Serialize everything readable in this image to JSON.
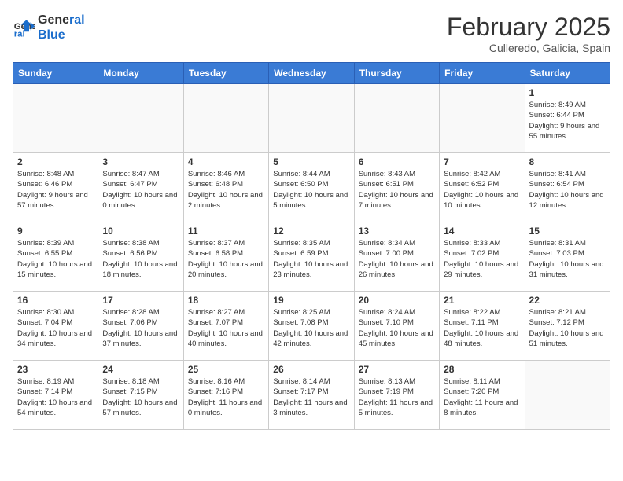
{
  "header": {
    "logo_line1": "General",
    "logo_line2": "Blue",
    "month": "February 2025",
    "location": "Culleredo, Galicia, Spain"
  },
  "weekdays": [
    "Sunday",
    "Monday",
    "Tuesday",
    "Wednesday",
    "Thursday",
    "Friday",
    "Saturday"
  ],
  "weeks": [
    [
      {
        "day": "",
        "info": ""
      },
      {
        "day": "",
        "info": ""
      },
      {
        "day": "",
        "info": ""
      },
      {
        "day": "",
        "info": ""
      },
      {
        "day": "",
        "info": ""
      },
      {
        "day": "",
        "info": ""
      },
      {
        "day": "1",
        "info": "Sunrise: 8:49 AM\nSunset: 6:44 PM\nDaylight: 9 hours\nand 55 minutes."
      }
    ],
    [
      {
        "day": "2",
        "info": "Sunrise: 8:48 AM\nSunset: 6:46 PM\nDaylight: 9 hours\nand 57 minutes."
      },
      {
        "day": "3",
        "info": "Sunrise: 8:47 AM\nSunset: 6:47 PM\nDaylight: 10 hours\nand 0 minutes."
      },
      {
        "day": "4",
        "info": "Sunrise: 8:46 AM\nSunset: 6:48 PM\nDaylight: 10 hours\nand 2 minutes."
      },
      {
        "day": "5",
        "info": "Sunrise: 8:44 AM\nSunset: 6:50 PM\nDaylight: 10 hours\nand 5 minutes."
      },
      {
        "day": "6",
        "info": "Sunrise: 8:43 AM\nSunset: 6:51 PM\nDaylight: 10 hours\nand 7 minutes."
      },
      {
        "day": "7",
        "info": "Sunrise: 8:42 AM\nSunset: 6:52 PM\nDaylight: 10 hours\nand 10 minutes."
      },
      {
        "day": "8",
        "info": "Sunrise: 8:41 AM\nSunset: 6:54 PM\nDaylight: 10 hours\nand 12 minutes."
      }
    ],
    [
      {
        "day": "9",
        "info": "Sunrise: 8:39 AM\nSunset: 6:55 PM\nDaylight: 10 hours\nand 15 minutes."
      },
      {
        "day": "10",
        "info": "Sunrise: 8:38 AM\nSunset: 6:56 PM\nDaylight: 10 hours\nand 18 minutes."
      },
      {
        "day": "11",
        "info": "Sunrise: 8:37 AM\nSunset: 6:58 PM\nDaylight: 10 hours\nand 20 minutes."
      },
      {
        "day": "12",
        "info": "Sunrise: 8:35 AM\nSunset: 6:59 PM\nDaylight: 10 hours\nand 23 minutes."
      },
      {
        "day": "13",
        "info": "Sunrise: 8:34 AM\nSunset: 7:00 PM\nDaylight: 10 hours\nand 26 minutes."
      },
      {
        "day": "14",
        "info": "Sunrise: 8:33 AM\nSunset: 7:02 PM\nDaylight: 10 hours\nand 29 minutes."
      },
      {
        "day": "15",
        "info": "Sunrise: 8:31 AM\nSunset: 7:03 PM\nDaylight: 10 hours\nand 31 minutes."
      }
    ],
    [
      {
        "day": "16",
        "info": "Sunrise: 8:30 AM\nSunset: 7:04 PM\nDaylight: 10 hours\nand 34 minutes."
      },
      {
        "day": "17",
        "info": "Sunrise: 8:28 AM\nSunset: 7:06 PM\nDaylight: 10 hours\nand 37 minutes."
      },
      {
        "day": "18",
        "info": "Sunrise: 8:27 AM\nSunset: 7:07 PM\nDaylight: 10 hours\nand 40 minutes."
      },
      {
        "day": "19",
        "info": "Sunrise: 8:25 AM\nSunset: 7:08 PM\nDaylight: 10 hours\nand 42 minutes."
      },
      {
        "day": "20",
        "info": "Sunrise: 8:24 AM\nSunset: 7:10 PM\nDaylight: 10 hours\nand 45 minutes."
      },
      {
        "day": "21",
        "info": "Sunrise: 8:22 AM\nSunset: 7:11 PM\nDaylight: 10 hours\nand 48 minutes."
      },
      {
        "day": "22",
        "info": "Sunrise: 8:21 AM\nSunset: 7:12 PM\nDaylight: 10 hours\nand 51 minutes."
      }
    ],
    [
      {
        "day": "23",
        "info": "Sunrise: 8:19 AM\nSunset: 7:14 PM\nDaylight: 10 hours\nand 54 minutes."
      },
      {
        "day": "24",
        "info": "Sunrise: 8:18 AM\nSunset: 7:15 PM\nDaylight: 10 hours\nand 57 minutes."
      },
      {
        "day": "25",
        "info": "Sunrise: 8:16 AM\nSunset: 7:16 PM\nDaylight: 11 hours\nand 0 minutes."
      },
      {
        "day": "26",
        "info": "Sunrise: 8:14 AM\nSunset: 7:17 PM\nDaylight: 11 hours\nand 3 minutes."
      },
      {
        "day": "27",
        "info": "Sunrise: 8:13 AM\nSunset: 7:19 PM\nDaylight: 11 hours\nand 5 minutes."
      },
      {
        "day": "28",
        "info": "Sunrise: 8:11 AM\nSunset: 7:20 PM\nDaylight: 11 hours\nand 8 minutes."
      },
      {
        "day": "",
        "info": ""
      }
    ]
  ]
}
